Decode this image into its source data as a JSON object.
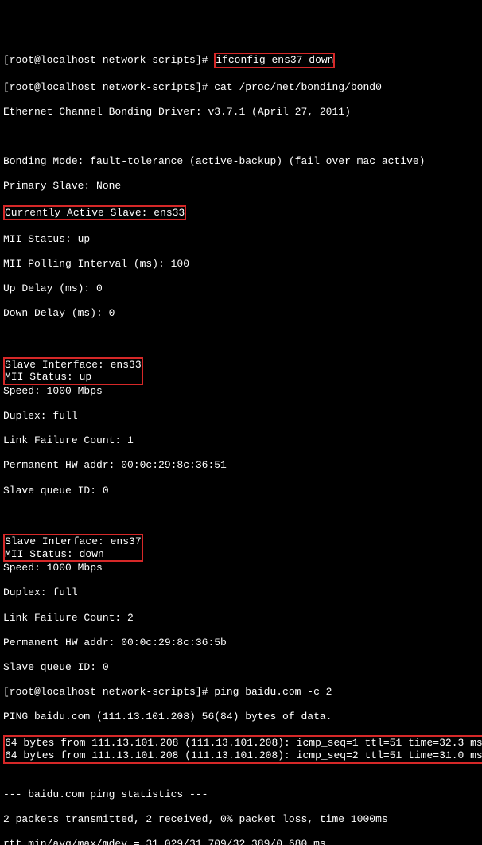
{
  "prompt1_prefix": "[root@localhost network-scripts]# ",
  "prompt1_cmd": "ifconfig ens37 down",
  "prompt2": "[root@localhost network-scripts]# cat /proc/net/bonding/bond0",
  "driver_line": "Ethernet Channel Bonding Driver: v3.7.1 (April 27, 2011)",
  "bonding_mode": "Bonding Mode: fault-tolerance (active-backup) (fail_over_mac active)",
  "primary_slave": "Primary Slave: None",
  "active_slave": "Currently Active Slave: ens33",
  "mii_status_up1": "MII Status: up",
  "mii_polling": "MII Polling Interval (ms): 100",
  "up_delay": "Up Delay (ms): 0",
  "down_delay": "Down Delay (ms): 0",
  "slave1_iface": "Slave Interface: ens33",
  "slave1_mii": "MII Status: up",
  "slave1_speed": "Speed: 1000 Mbps",
  "slave1_duplex": "Duplex: full",
  "slave1_failcount": "Link Failure Count: 1",
  "slave1_hwaddr": "Permanent HW addr: 00:0c:29:8c:36:51",
  "slave1_queue": "Slave queue ID: 0",
  "slave2_iface": "Slave Interface: ens37",
  "slave2_mii": "MII Status: down",
  "slave2_speed": "Speed: 1000 Mbps",
  "slave2_duplex": "Duplex: full",
  "slave2_failcount": "Link Failure Count: 2",
  "slave2_hwaddr": "Permanent HW addr: 00:0c:29:8c:36:5b",
  "slave2_queue": "Slave queue ID: 0",
  "prompt3": "[root@localhost network-scripts]# ping baidu.com -c 2",
  "ping_header": "PING baidu.com (111.13.101.208) 56(84) bytes of data.",
  "ping_reply1": "64 bytes from 111.13.101.208 (111.13.101.208): icmp_seq=1 ttl=51 time=32.3 ms",
  "ping_reply2": "64 bytes from 111.13.101.208 (111.13.101.208): icmp_seq=2 ttl=51 time=31.0 ms",
  "ping_stats_header": "--- baidu.com ping statistics ---",
  "ping_stats_line1": "2 packets transmitted, 2 received, 0% packet loss, time 1000ms",
  "ping_stats_line2": "rtt min/avg/max/mdev = 31.029/31.709/32.389/0.680 ms"
}
